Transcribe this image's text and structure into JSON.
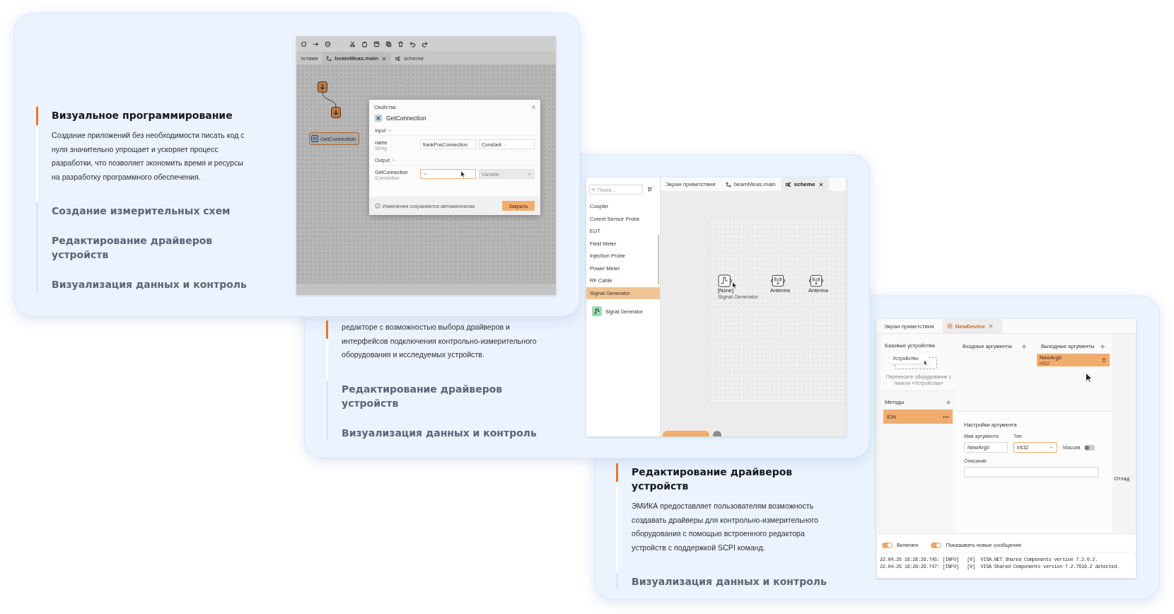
{
  "cards": [
    {
      "features": [
        {
          "title": "Визуальное программирование",
          "description": "Создание приложений без необходимости писать код с нуля значительно упрощает и ускоряет процесс разработки, что позволяет экономить время и ресурсы на разработку программного обеспечения.",
          "selected": true
        },
        {
          "title": "Создание измерительных схем",
          "selected": false
        },
        {
          "title": "Редактирование драйверов устройств",
          "selected": false
        },
        {
          "title": "Визуализация данных и контроль",
          "selected": false
        }
      ],
      "screen": {
        "kind": "visual_editor",
        "tabs": [
          {
            "label": "тствия",
            "selected": false
          },
          {
            "label": "beamMeas.main",
            "kind": "program",
            "selected": true
          },
          {
            "label": "scheme",
            "kind": "scheme",
            "selected": false
          }
        ],
        "nodes": [
          {
            "kind": "step"
          },
          {
            "kind": "step"
          },
          {
            "kind": "block",
            "label": "GetConnection",
            "selected": true
          }
        ],
        "dialog": {
          "title": "Свойства",
          "name": "GetConnection",
          "sections": [
            {
              "label": "Input",
              "expanded": true,
              "rows": [
                {
                  "name": "name",
                  "type": "String",
                  "value": "frankPosConnection",
                  "focused": false,
                  "mode": {
                    "label": "Constant",
                    "disabled": false
                  }
                }
              ]
            },
            {
              "label": "Output",
              "expanded": true,
              "rows": [
                {
                  "name": "GetConnection",
                  "type": "IConnection",
                  "focused": true,
                  "mode": {
                    "label": "Variable",
                    "disabled": true
                  }
                }
              ]
            }
          ],
          "note": "Изменения сохраняются автоматически",
          "button": "Закрыть"
        }
      }
    },
    {
      "features": [
        {
          "description": "редакторе с возможностью выбора драйверов и интерфейсов подключения контрольно-измерительного оборудования и исследуемых устройств.",
          "selected": true
        },
        {
          "title": "Редактирование драйверов устройств",
          "selected": false
        },
        {
          "title": "Визуализация данных и контроль",
          "selected": false
        }
      ],
      "screen": {
        "kind": "scheme_editor",
        "search": {
          "placeholder": "Поиск..."
        },
        "categories": [
          {
            "label": "Coupler",
            "selected": false
          },
          {
            "label": "Curent Sensor Probe",
            "selected": false
          },
          {
            "label": "EUT",
            "selected": false
          },
          {
            "label": "Field Meter",
            "selected": false
          },
          {
            "label": "Injection Probe",
            "selected": false
          },
          {
            "label": "Power Meter",
            "selected": false
          },
          {
            "label": "RF Cable",
            "selected": false
          },
          {
            "label": "Signal Generator",
            "selected": true
          }
        ],
        "devices": [
          {
            "label": "Signal Generator"
          }
        ],
        "tabs": [
          {
            "label": "Экран приветствия",
            "kind": "welcome",
            "selected": false
          },
          {
            "label": "beamMeas.main",
            "kind": "program",
            "selected": false
          },
          {
            "label": "scheme",
            "kind": "scheme",
            "selected": true
          }
        ],
        "nodes": [
          {
            "kind": "generator",
            "label": "[None]",
            "sublabel": "Signal Generator"
          },
          {
            "kind": "antenna",
            "label": "Antenna"
          },
          {
            "kind": "antenna",
            "label": "Antenna"
          }
        ]
      }
    },
    {
      "features": [
        {
          "title": "Редактирование драйверов устройств",
          "description": "ЭМИКА предоставляет пользователям возможность создавать драйверы для контрольно-измерительного оборудования с помощью встроенного редактора устройств с поддержкой SCPI команд.",
          "selected": true
        },
        {
          "title": "Визуализация данных и контроль",
          "selected": false
        }
      ],
      "screen": {
        "kind": "device_editor",
        "tabs": [
          {
            "label": "Экран приветствия",
            "kind": "welcome",
            "selected": false
          },
          {
            "label": "NewDevice",
            "kind": "device",
            "selected": true
          }
        ],
        "base_devices": {
          "title": "Базовые устройства",
          "device": "Устройство",
          "hint": "Перенесите оборудование с панели «Устройства»"
        },
        "methods": {
          "title": "Методы",
          "items": [
            {
              "label": "IDN",
              "selected": true
            }
          ]
        },
        "inputs": {
          "title": "Входные аргументы"
        },
        "outputs": {
          "title": "Выходные аргументы",
          "items": [
            {
              "name": "NewArg0",
              "type": "int32",
              "selected": true
            }
          ]
        },
        "settings": {
          "title": "Настройки аргумента",
          "name_label": "Имя аргумента",
          "name_value": "NewArg0",
          "type_label": "Тип",
          "type_value": "int32",
          "array_label": "Массив",
          "array_on": false,
          "description_label": "Описание"
        },
        "side_label": "Отлад",
        "toggles": [
          {
            "label": "Включен",
            "on": true
          },
          {
            "label": "Показывать новые сообщения",
            "on": true
          }
        ],
        "log": [
          "22.04.25 16:28:29.745: [INFO]   [0]  VISA.NET Shared Components version 7.2.0.2.",
          "22.04.25 16:28:29.747: [INFO]   [0]  VISA Shared Components version 7.2.7619.2 detected."
        ]
      }
    }
  ]
}
